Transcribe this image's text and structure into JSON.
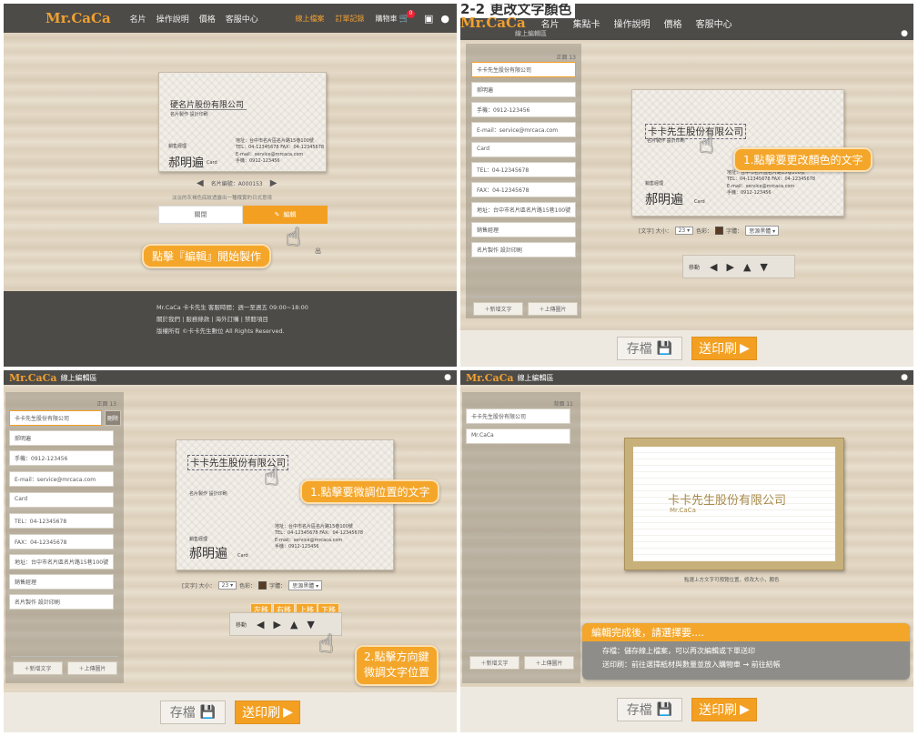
{
  "panel1": {
    "logo": "Mr.CaCa",
    "nav": [
      "名片",
      "操作說明",
      "價格",
      "客服中心"
    ],
    "links": [
      "線上檔案",
      "訂單記錄",
      "購物車"
    ],
    "cart_count": "0",
    "card": {
      "company": "硬名片股份有限公司",
      "tagline": "名片製作  設計印刷",
      "title": "銷售經理",
      "name": "郝明遍",
      "name_en": "Card",
      "address": "地址：台中市名片區名片路15巷100號",
      "tel_fax": "TEL：04-12345678    FAX：04-12345678",
      "email": "E-mail：service@mrcaca.com",
      "mobile": "手機：0912-123456"
    },
    "card_number": "名片編號：A000153",
    "hint": "淡淡的灰褐色底紋透露出一種樸實的日式意境",
    "close_label": "關閉",
    "edit_label": "編輯",
    "callout": "點擊『編輯』開始製作",
    "exit_fragment": "出",
    "footer_line1": "Mr.CaCa 卡卡先生 客服時間：週一至週五 09:00~18:00",
    "footer_line2": "關於我們 | 服務條款 | 海外訂購 | 禁聽項目",
    "footer_line3": "版權所有 ©卡卡先生數位 All Rights Reserved."
  },
  "panel2": {
    "heading": "2-2 更改文字顏色",
    "logo": "Mr.CaCa",
    "nav": [
      "名片",
      "集點卡",
      "操作說明",
      "價格",
      "客服中心"
    ],
    "editor_title": "線上編輯區",
    "side_count": "正面 13",
    "fields": [
      "卡卡先生股份有限公司",
      "郝明遍",
      "手機：0912-123456",
      "E-mail：service@mrcaca.com",
      "Card",
      "TEL：04-12345678",
      "FAX：04-12345678",
      "地址：台中市名片區名片路15巷100號",
      "銷售經理",
      "名片製作  設計印刷"
    ],
    "add_text": "＋新增文字",
    "upload_image": "＋上傳圖片",
    "card": {
      "company": "卡卡先生股份有限公司",
      "tagline": "名片製作  設計印刷",
      "title": "銷售經理",
      "name": "郝明遍",
      "name_en": "Card",
      "address": "地址：台中市名片區名片路15巷100號",
      "tel_fax": "TEL：04-12345678    FAX：04-12345678",
      "email": "E-mail：service@mrcaca.com",
      "mobile": "手機：0912-123456"
    },
    "callout": "1.點擊要更改顏色的文字",
    "toolbar": {
      "type_label": "[文字] 大小：",
      "size": "23 ▾",
      "color_label": "色彩：",
      "font_label": "字體：",
      "font": "思源黑體 ▾"
    },
    "move_label": "移動",
    "save_label": "存檔",
    "print_label": "送印刷"
  },
  "panel3": {
    "logo": "Mr.CaCa",
    "editor_title": "線上編輯區",
    "side_count": "正面 13",
    "fields": [
      "卡卡先生股份有限公司",
      "郝明遍",
      "手機：0912-123456",
      "E-mail：service@mrcaca.com",
      "Card",
      "TEL：04-12345678",
      "FAX：04-12345678",
      "地址：台中市名片區名片路15巷100號",
      "銷售經理",
      "名片製作  設計印刷"
    ],
    "delete_label": "刪除",
    "add_text": "＋新增文字",
    "upload_image": "＋上傳圖片",
    "card": {
      "company": "卡卡先生股份有限公司",
      "tagline": "名片製作  設計印刷",
      "title": "銷售經理",
      "name": "郝明遍",
      "name_en": "Card",
      "address": "地址：台中市名片區名片路15巷100號",
      "tel_fax": "TEL：04-12345678    FAX：04-12345678",
      "email": "E-mail：service@mrcaca.com",
      "mobile": "手機：0912-123456"
    },
    "callout1": "1.點擊要微調位置的文字",
    "callout2_line1": "2.點擊方向鍵",
    "callout2_line2": "微調文字位置",
    "toolbar": {
      "type_label": "[文字] 大小：",
      "size": "23 ▾",
      "color_label": "色彩：",
      "font_label": "字體：",
      "font": "思源黑體 ▾"
    },
    "move_label": "移動",
    "dir_labels": [
      "左移",
      "右移",
      "上移",
      "下移"
    ],
    "save_label": "存檔",
    "print_label": "送印刷"
  },
  "panel4": {
    "logo": "Mr.CaCa",
    "editor_title": "線上編輯區",
    "side_count": "背面 11",
    "fields": [
      "卡卡先生股份有限公司",
      "Mr.CaCa"
    ],
    "add_text": "＋新增文字",
    "upload_image": "＋上傳圖片",
    "card_company": "卡卡先生股份有限公司",
    "card_sub": "Mr.CaCa",
    "hint": "點選上方文字可預覽位置，修改大小，顏色",
    "popup_title": "編輯完成後，請選擇要....",
    "popup_line1": "存檔：儲存線上檔案，可以再次編輯或下單送印",
    "popup_line2": "送印刷：前往選擇紙材與數量並放入購物車 → 前往結帳",
    "save_label": "存檔",
    "print_label": "送印刷"
  },
  "colors": {
    "accent": "#f4a62a",
    "topbar": "#4d4b48",
    "wood": "#e2d7c4"
  }
}
